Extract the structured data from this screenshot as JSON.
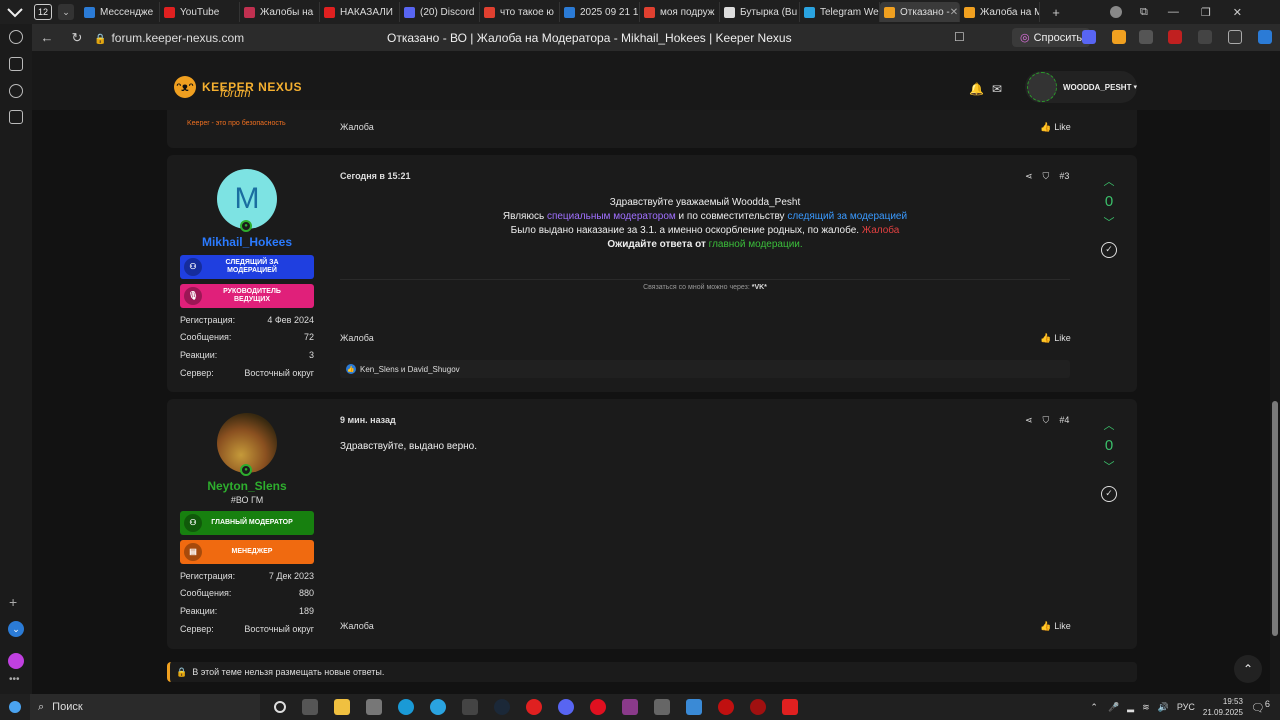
{
  "browser": {
    "tab_count": "12",
    "tabs": [
      {
        "label": "Мессендже",
        "color": "#2b7bd6"
      },
      {
        "label": "YouTube",
        "color": "#e02020"
      },
      {
        "label": "Жалобы на",
        "color": "#c03050"
      },
      {
        "label": "НАКАЗАЛИ",
        "color": "#e02020"
      },
      {
        "label": "(20) Discord",
        "color": "#5865f2"
      },
      {
        "label": "что такое ю",
        "color": "#e04030"
      },
      {
        "label": "2025 09 21 1",
        "color": "#2b7bd6"
      },
      {
        "label": "моя подруж",
        "color": "#e04030"
      },
      {
        "label": "Бутырка (Bu",
        "color": "#dddddd"
      },
      {
        "label": "Telegram We",
        "color": "#2aa3e0"
      },
      {
        "label": "Отказано -",
        "color": "#f0a020",
        "active": true
      },
      {
        "label": "Жалоба на М",
        "color": "#f0a020"
      }
    ],
    "url": "forum.keeper-nexus.com",
    "page_title": "Отказано - ВО | Жалоба на Модератора - Mikhail_Hokees | Keeper Nexus",
    "ask_button": "Спросить"
  },
  "site": {
    "logo_text": "KEEPER NEXUS",
    "logo_sub": "forum",
    "tagline": "Keeper - это про безопасность",
    "username": "WOODDA_PESHT"
  },
  "prev_post": {
    "footer_label": "Жалоба",
    "like": "Like"
  },
  "post3": {
    "avatar_letter": "M",
    "username": "Mikhail_Hokees",
    "username_color": "#2b7bff",
    "banners": [
      {
        "label": "СЛЕДЯЩИЙ ЗА МОДЕРАЦИЕЙ",
        "color": "#1f3fe0"
      },
      {
        "label": "РУКОВОДИТЕЛЬ ВЕДУЩИХ",
        "color": "#e0207a"
      }
    ],
    "stats": [
      {
        "label": "Регистрация:",
        "value": "4 Фев 2024"
      },
      {
        "label": "Сообщения:",
        "value": "72"
      },
      {
        "label": "Реакции:",
        "value": "3"
      },
      {
        "label": "Сервер:",
        "value": "Восточный округ"
      }
    ],
    "date": "Сегодня в 15:21",
    "number": "#3",
    "votes": "0",
    "lines": {
      "l1": "Здравствуйте уважаемый Woodda_Pesht",
      "l2a": "Являюсь ",
      "l2b": "специальным модератором",
      "l2c": " и по совместительству ",
      "l2d": "следящий за модерацией",
      "l3a": "Было выдано наказание за 3.1. а именно оскорбление родных, по жалобе. ",
      "l3b": "Жалоба",
      "l4a": "Ожидайте ответа от ",
      "l4b": "главной модерации."
    },
    "signature_a": "Связаться со мной можно через: ",
    "signature_b": "*VK*",
    "footer_label": "Жалоба",
    "like": "Like",
    "reactions": "Ken_Slens и David_Shugov"
  },
  "post4": {
    "username": "Neyton_Slens",
    "username_color": "#2eae2e",
    "user_title": "#ВО ГМ",
    "banners": [
      {
        "label": "ГЛАВНЫЙ МОДЕРАТОР",
        "color": "#17800f"
      },
      {
        "label": "МЕНЕДЖЕР",
        "color": "#f06a10"
      }
    ],
    "stats": [
      {
        "label": "Регистрация:",
        "value": "7 Дек 2023"
      },
      {
        "label": "Сообщения:",
        "value": "880"
      },
      {
        "label": "Реакции:",
        "value": "189"
      },
      {
        "label": "Сервер:",
        "value": "Восточный округ"
      }
    ],
    "date": "9 мин. назад",
    "number": "#4",
    "votes": "0",
    "text": "Здравствуйте, выдано верно.",
    "footer_label": "Жалоба",
    "like": "Like"
  },
  "locked_notice": "В этой теме нельзя размещать новые ответы.",
  "taskbar": {
    "search": "Поиск",
    "lang": "РУС",
    "time": "19:53",
    "date": "21.09.2025",
    "notif": "6"
  }
}
